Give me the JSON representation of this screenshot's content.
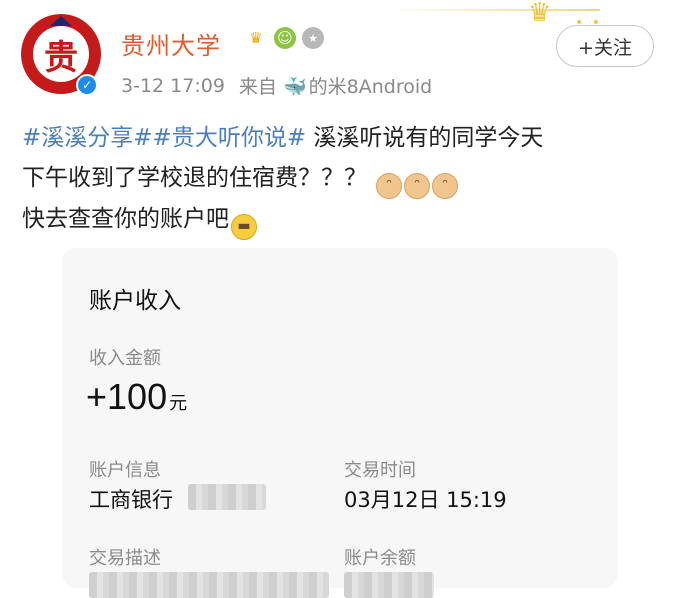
{
  "account": {
    "name": "贵州大学",
    "avatar_text": "贵",
    "badges": [
      "crown-icon",
      "face-icon",
      "medal-icon"
    ]
  },
  "post_meta": {
    "timestamp": "3-12 17:09",
    "source_prefix": "来自",
    "source": "的米8Android"
  },
  "follow_button": {
    "label": "+关注"
  },
  "post": {
    "tag1": "#溪溪分享#",
    "tag2": "#贵大听你说#",
    "line1": " 溪溪听说有的同学今天",
    "line2": "下午收到了学校退的住宿费？？？",
    "line3": "快去查查你的账户吧"
  },
  "card": {
    "title": "账户收入",
    "amount_label": "收入金额",
    "amount": "+100",
    "amount_unit": "元",
    "account_info_label": "账户信息",
    "account_info_value": "工商银行",
    "time_label": "交易时间",
    "time_value": "03月12日 15:19",
    "desc_label": "交易描述",
    "balance_label": "账户余额"
  },
  "colors": {
    "name": "#e8592b",
    "tag": "#4a7fc0",
    "verified": "#1c8ce8"
  }
}
